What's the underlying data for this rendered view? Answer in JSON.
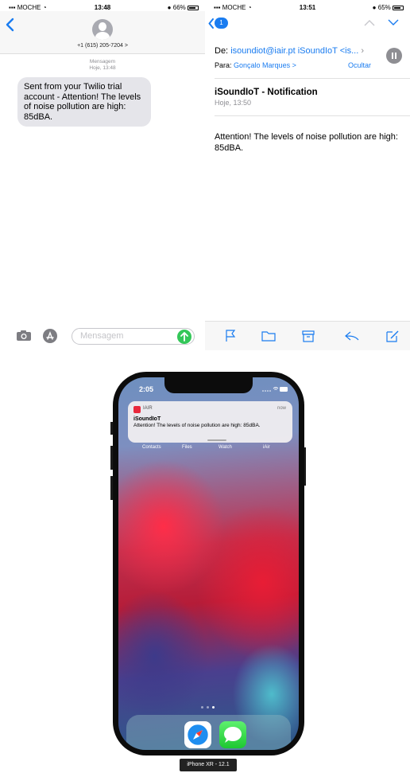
{
  "sms": {
    "status": {
      "carrier": "MOCHE",
      "time": "13:48",
      "battery": "66%"
    },
    "contact_number": "+1 (615) 205-7204 >",
    "meta_label": "Mensagem",
    "meta_time": "Hoje, 13:48",
    "message": "Sent from your Twilio trial account - Attention! The levels of noise pollution are high: 85dBA.",
    "input_placeholder": "Mensagem"
  },
  "mail": {
    "status": {
      "carrier": "MOCHE",
      "time": "13:51",
      "battery": "65%"
    },
    "back_badge": "1",
    "from_label": "De:",
    "from_value": "isoundiot@iair.pt iSoundIoT <is...",
    "to_label": "Para:",
    "to_value": "Gonçalo Marques >",
    "hide_label": "Ocultar",
    "subject": "iSoundIoT - Notification",
    "date": "Hoje, 13:50",
    "body": "Attention! The levels of noise pollution are high: 85dBA."
  },
  "phone": {
    "time": "2:05",
    "notification": {
      "app": "IAIR",
      "time": "now",
      "title": "iSoundIoT",
      "body": "Attention! The levels of noise pollution are high: 85dBA."
    },
    "app_labels": [
      "Contacts",
      "Files",
      "Watch",
      "iAir"
    ],
    "dock_apps": [
      "safari-icon",
      "messages-icon"
    ],
    "device_label": "iPhone XR - 12.1"
  }
}
